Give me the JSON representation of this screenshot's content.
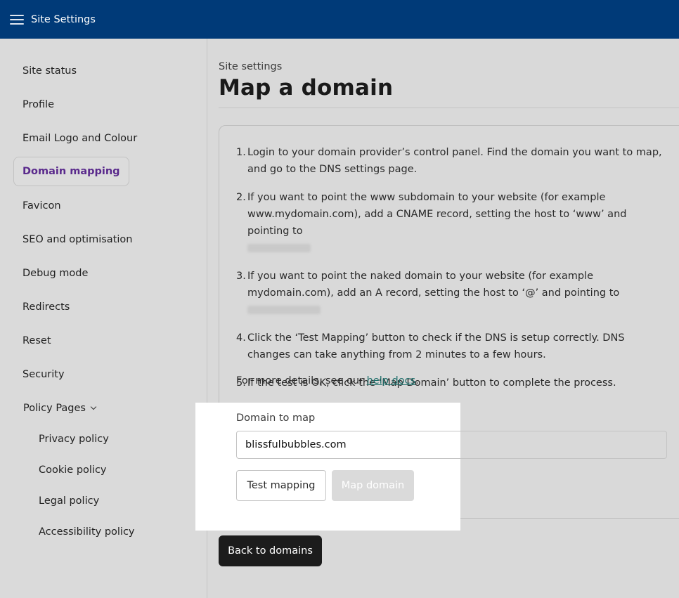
{
  "header": {
    "title": "Site Settings",
    "menu_icon": "hamburger-menu-icon",
    "bg_color": "#003a78"
  },
  "sidebar": {
    "items": [
      {
        "label": "Site status"
      },
      {
        "label": "Profile"
      },
      {
        "label": "Email Logo and Colour"
      },
      {
        "label": "Domain mapping",
        "active": true
      },
      {
        "label": "Favicon"
      },
      {
        "label": "SEO and optimisation"
      },
      {
        "label": "Debug mode"
      },
      {
        "label": "Redirects"
      },
      {
        "label": "Reset"
      },
      {
        "label": "Security"
      },
      {
        "label": "Policy Pages",
        "expanded": true
      }
    ],
    "policy_items": [
      {
        "label": "Privacy policy"
      },
      {
        "label": "Cookie policy"
      },
      {
        "label": "Legal policy"
      },
      {
        "label": "Accessibility policy"
      }
    ],
    "active_color": "#5a2a8c"
  },
  "main": {
    "breadcrumb": "Site settings",
    "title": "Map a domain",
    "steps": [
      {
        "num": "1.",
        "text": "Login to your domain provider’s control panel. Find the domain you want to map, and go to the DNS settings page."
      },
      {
        "num": "2.",
        "text": "If you want to point the www subdomain to your website (for example www.mydomain.com), add a CNAME record, setting the host to ‘www’ and pointing to"
      },
      {
        "num": "3.",
        "text": "If you want to point the naked domain to your website (for example mydomain.com), add an A record, setting the host to ‘@’ and pointing to"
      },
      {
        "num": "4.",
        "text": "Click the ‘Test Mapping’ button to check if the DNS is setup correctly. DNS changes can take anything from 2 minutes to a few hours."
      },
      {
        "num": "5.",
        "text": "If the test is OK, click the ‘Map Domain’ button to complete the process."
      }
    ],
    "details_prefix": "For more details, see our ",
    "details_link": "help docs",
    "details_suffix": ".",
    "link_color": "#1e6e6a",
    "domain_label": "Domain to map",
    "domain_value": "blissfulbubbles.com",
    "test_button": "Test mapping",
    "map_button": "Map domain",
    "back_button": "Back to domains"
  }
}
